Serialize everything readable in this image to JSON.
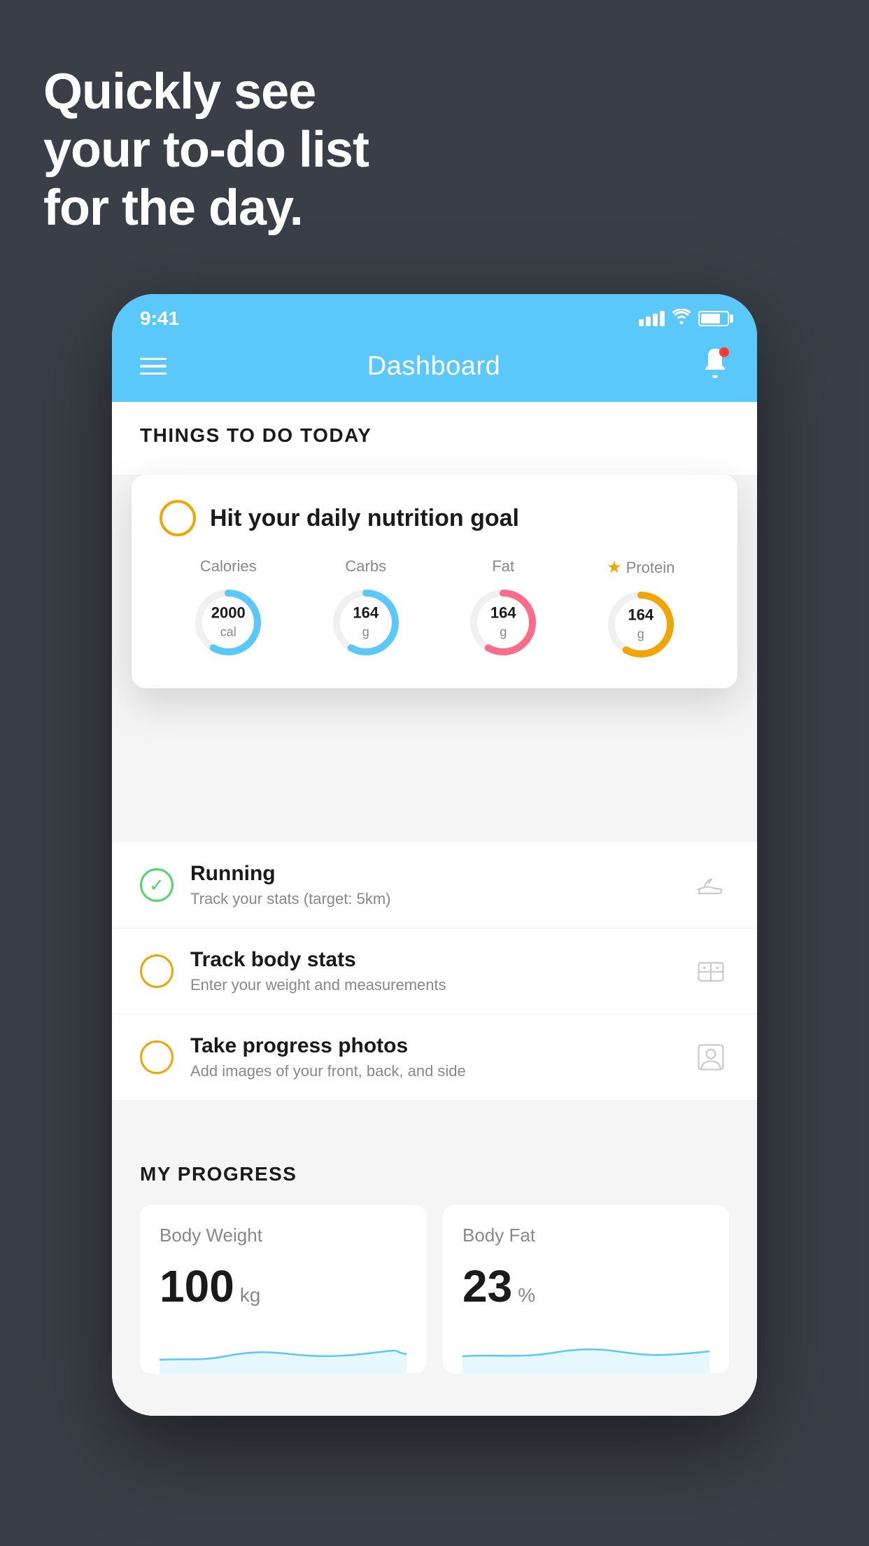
{
  "headline": {
    "line1": "Quickly see",
    "line2": "your to-do list",
    "line3": "for the day."
  },
  "status_bar": {
    "time": "9:41"
  },
  "nav": {
    "title": "Dashboard"
  },
  "things_section": {
    "header": "THINGS TO DO TODAY"
  },
  "nutrition_card": {
    "title": "Hit your daily nutrition goal",
    "items": [
      {
        "label": "Calories",
        "value": "2000",
        "unit": "cal",
        "color": "blue",
        "starred": false
      },
      {
        "label": "Carbs",
        "value": "164",
        "unit": "g",
        "color": "blue",
        "starred": false
      },
      {
        "label": "Fat",
        "value": "164",
        "unit": "g",
        "color": "pink",
        "starred": false
      },
      {
        "label": "Protein",
        "value": "164",
        "unit": "g",
        "color": "yellow",
        "starred": true
      }
    ]
  },
  "todo_items": [
    {
      "title": "Running",
      "subtitle": "Track your stats (target: 5km)",
      "status": "active",
      "icon": "shoe"
    },
    {
      "title": "Track body stats",
      "subtitle": "Enter your weight and measurements",
      "status": "pending",
      "icon": "scale"
    },
    {
      "title": "Take progress photos",
      "subtitle": "Add images of your front, back, and side",
      "status": "pending",
      "icon": "portrait"
    }
  ],
  "progress_section": {
    "header": "MY PROGRESS",
    "cards": [
      {
        "title": "Body Weight",
        "value": "100",
        "unit": "kg"
      },
      {
        "title": "Body Fat",
        "value": "23",
        "unit": "%"
      }
    ]
  }
}
